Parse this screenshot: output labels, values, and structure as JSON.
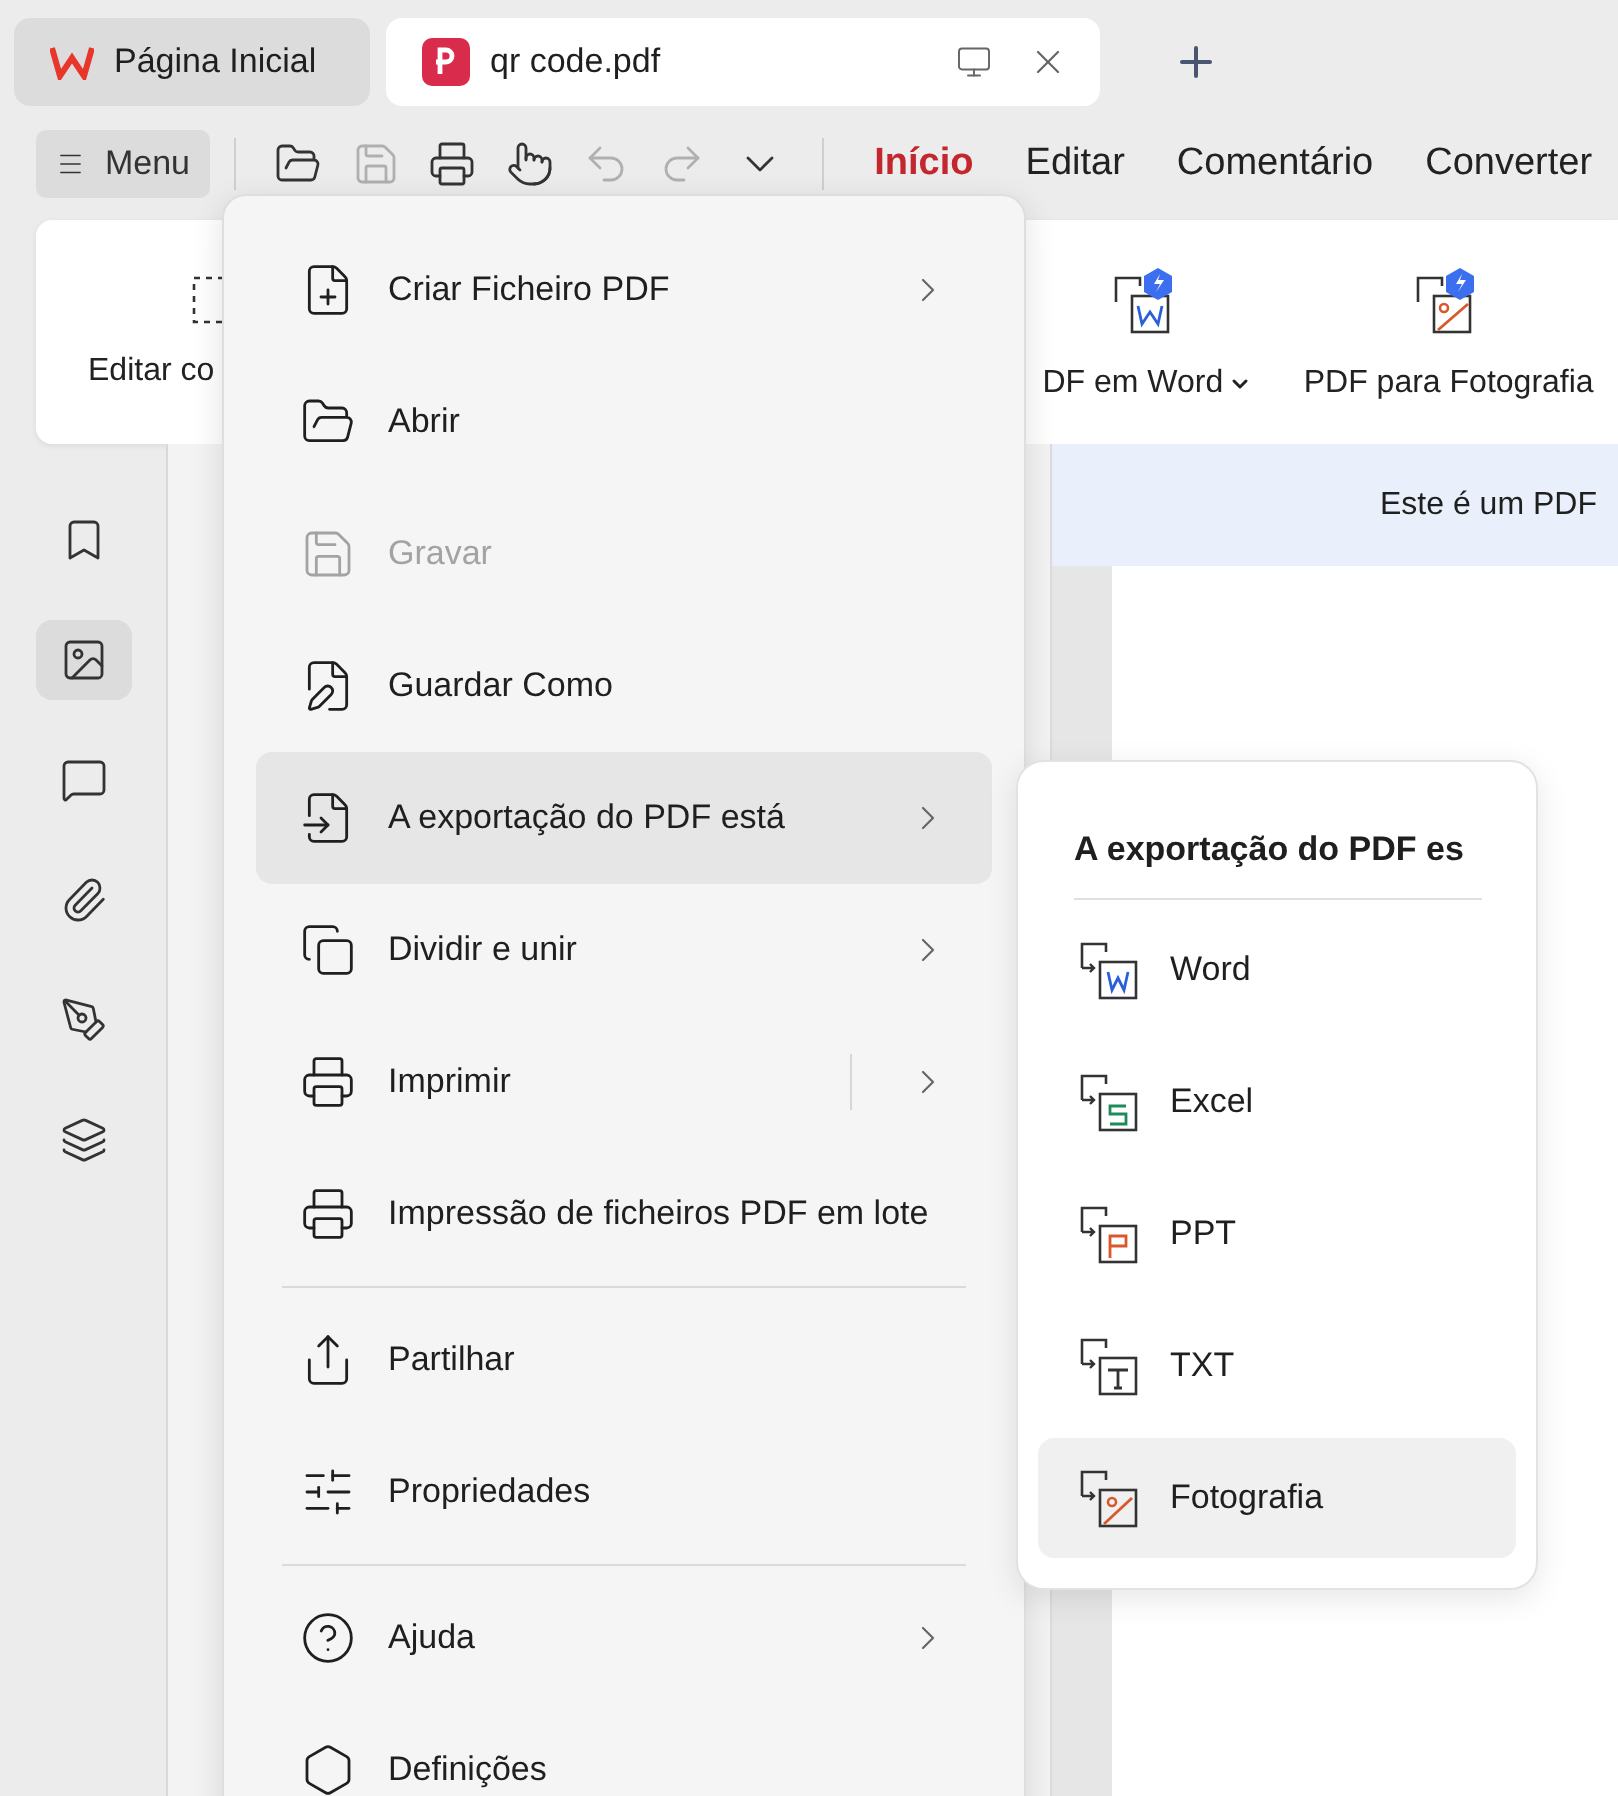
{
  "tabs": [
    {
      "label": "Página Inicial",
      "kind": "home",
      "selected": false
    },
    {
      "label": "qr code.pdf",
      "kind": "document",
      "selected": true
    }
  ],
  "menu_button": {
    "label": "Menu"
  },
  "quick_tools": [
    {
      "kind": "open",
      "disabled": false
    },
    {
      "kind": "save",
      "disabled": true
    },
    {
      "kind": "print",
      "disabled": false
    },
    {
      "kind": "hand",
      "disabled": false
    },
    {
      "kind": "undo",
      "disabled": true
    },
    {
      "kind": "redo",
      "disabled": true
    },
    {
      "kind": "more",
      "disabled": false
    }
  ],
  "ribbon_tabs": [
    {
      "label": "Início",
      "selected": true
    },
    {
      "label": "Editar",
      "selected": false
    },
    {
      "label": "Comentário",
      "selected": false
    },
    {
      "label": "Converter",
      "selected": false
    }
  ],
  "ribbon_tools": [
    {
      "label": "Editar co",
      "kind": "edit"
    },
    {
      "label": "DF em Word",
      "kind": "word",
      "dropdown": true
    },
    {
      "label": "PDF para Fotografia",
      "kind": "photo",
      "dropdown": false
    }
  ],
  "sidebar": [
    {
      "kind": "bookmark",
      "selected": false
    },
    {
      "kind": "thumbnail",
      "selected": true
    },
    {
      "kind": "comment",
      "selected": false
    },
    {
      "kind": "attachment",
      "selected": false
    },
    {
      "kind": "sign",
      "selected": false
    },
    {
      "kind": "layers",
      "selected": false
    }
  ],
  "banner": {
    "text": "Este é um PDF"
  },
  "file_menu": {
    "groups": [
      [
        {
          "label": "Criar Ficheiro PDF",
          "kind": "create",
          "disabled": false,
          "submenu": true,
          "split": false,
          "selected": false
        },
        {
          "label": "Abrir",
          "kind": "open",
          "disabled": false,
          "submenu": false,
          "split": false,
          "selected": false
        },
        {
          "label": "Gravar",
          "kind": "save",
          "disabled": true,
          "submenu": false,
          "split": false,
          "selected": false
        },
        {
          "label": "Guardar Como",
          "kind": "saveas",
          "disabled": false,
          "submenu": false,
          "split": false,
          "selected": false
        },
        {
          "label": "A exportação do PDF está",
          "kind": "export",
          "disabled": false,
          "submenu": true,
          "split": false,
          "selected": true
        },
        {
          "label": "Dividir e unir",
          "kind": "split",
          "disabled": false,
          "submenu": true,
          "split": false,
          "selected": false
        },
        {
          "label": "Imprimir",
          "kind": "print",
          "disabled": false,
          "submenu": true,
          "split": true,
          "selected": false
        },
        {
          "label": "Impressão de ficheiros PDF em lote",
          "kind": "batchprint",
          "disabled": false,
          "submenu": false,
          "split": false,
          "selected": false
        }
      ],
      [
        {
          "label": "Partilhar",
          "kind": "share",
          "disabled": false,
          "submenu": false,
          "split": false,
          "selected": false
        },
        {
          "label": "Propriedades",
          "kind": "properties",
          "disabled": false,
          "submenu": false,
          "split": false,
          "selected": false
        }
      ],
      [
        {
          "label": "Ajuda",
          "kind": "help",
          "disabled": false,
          "submenu": true,
          "split": false,
          "selected": false
        },
        {
          "label": "Definições",
          "kind": "settings",
          "disabled": false,
          "submenu": false,
          "split": false,
          "selected": false
        }
      ]
    ]
  },
  "export_submenu": {
    "title": "A exportação do PDF es",
    "items": [
      {
        "label": "Word",
        "kind": "word",
        "selected": false
      },
      {
        "label": "Excel",
        "kind": "excel",
        "selected": false
      },
      {
        "label": "PPT",
        "kind": "ppt",
        "selected": false
      },
      {
        "label": "TXT",
        "kind": "txt",
        "selected": false
      },
      {
        "label": "Fotografia",
        "kind": "photo",
        "selected": true
      }
    ]
  }
}
